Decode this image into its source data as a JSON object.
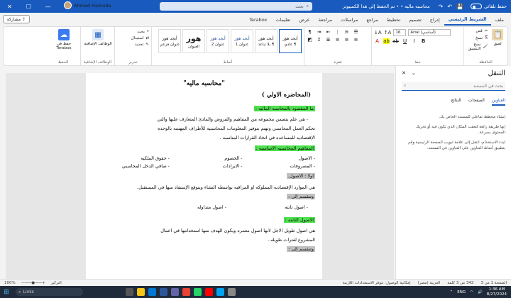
{
  "titlebar": {
    "autosave_label": "حفظ تلقائي",
    "doc_title": "محاسبه ماليه • • تم الحفظ إلى هذا الكمبيوتر",
    "search_placeholder": "بحث",
    "user_name": "Ahmed Hamada"
  },
  "tabs": [
    "ملف",
    "الشريط الرئيسي",
    "إدراج",
    "تصميم",
    "تخطيط",
    "مراجع",
    "مراسلات",
    "مراجعة",
    "عرض",
    "تعليمات",
    "Terabox"
  ],
  "active_tab": "الشريط الرئيسي",
  "share_label": "مشاركة",
  "ribbon": {
    "clipboard": {
      "label": "الحافظة",
      "paste": "لصق",
      "cut": "قص",
      "copy": "نسخ",
      "painter": "نسخ التنسيق"
    },
    "font": {
      "label": "خط",
      "name": "Arial (أساسي)",
      "size": "16"
    },
    "paragraph": {
      "label": "فقرة"
    },
    "styles": {
      "label": "أنماط",
      "items": [
        {
          "sample": "أبجد هوز",
          "name": "¶ عادي",
          "kind": "normal"
        },
        {
          "sample": "أبجد هوز",
          "name": "¶ بلا تباعد",
          "kind": "normal"
        },
        {
          "sample": "أبجد هوز",
          "name": "عنوان 1",
          "kind": "blue"
        },
        {
          "sample": "أبجد هوز",
          "name": "عنوان 2",
          "kind": "blue"
        },
        {
          "sample": "هور",
          "name": "العنوان",
          "kind": "big"
        },
        {
          "sample": "أبجد هوز",
          "name": "عنوان فرعي",
          "kind": "normal"
        }
      ]
    },
    "editing": {
      "label": "تحرير",
      "find": "بحث",
      "replace": "استبدال",
      "select": "تحديد"
    },
    "addins": {
      "label": "الوظائف الإضافية",
      "btn": "الوظائف الإضافية"
    },
    "save": {
      "label": "الحفظ",
      "btn": "حفظ في Terabox"
    }
  },
  "document": {
    "title": "\"محاسبه ماليه\"",
    "subtitle": "(المحاضره الاولي )",
    "h1": "ما المقصود بالمحاسبه الماليه :",
    "p1a": "-   هي علم يتضمن مجموعه من المفاهيم والفروض والمادئ المتعارف عليها والتي",
    "p1b": "تحكم العمل المحاسبي وتهتم بتوفير المعلومات المحاسبيه للأطراف المهتمه بالوحده",
    "p1c": "الإقتصاديه للمساعده في اتخاذ القرارات المناسبه .",
    "h2": "المفاهيم المحاسبيه الاساسيه :",
    "cols": [
      [
        "-   الاصول",
        "-   المصروفات"
      ],
      [
        "-   الخصوم",
        "-   الايرادات"
      ],
      [
        "-   حقوق الملكيه",
        "-   صافي الدخل المحاسبي"
      ]
    ],
    "h3": "اولا : الاصول.",
    "p3": "هي الموارد الإقتصاديه المملوكه او المراقبه بواسطه النشاء ويتوقع الإستفاد منها في المستقبل.",
    "h4": "وتنقسم إلى :",
    "assets_fixed": "-   اصول ثابته",
    "assets_current": "-   اصول متداوله",
    "h5": "الاصول الثابته :",
    "p5a": "هي اصول طويل الاجل لانها اصول معمره ويكون الهدف منها استخدامها في اعمال",
    "p5b": "المشروع لفترات طويله..",
    "h6": "وتنقسم إلى :"
  },
  "nav": {
    "title": "التنقل",
    "search_placeholder": "بحث في المستند",
    "tabs": [
      "العناوين",
      "الصفحات",
      "النتائج"
    ],
    "active_tab": "العناوين",
    "text1": "إنشاء مخطط تفاعلي للمستند الخاص بك.",
    "text2": "إنها طريقة رائعة لتعقب المكان الذي تكون فيه أو تحريك المحتوى بسرعة.",
    "text3": "لبدء الاستخدام، انتقل إلى علامة تبويب الصفحة الرئيسية وقم بتطبيق أنماط العناوين على العناوين في المستند."
  },
  "status": {
    "page": "الصفحة 1 من 3",
    "words": "342 من 3 كلمة",
    "lang": "العربية (مصر)",
    "access": "إمكانية الوصول: تتوفر الاستعدادات اللازمة",
    "focus": "التركيز",
    "zoom": "100%"
  },
  "taskbar": {
    "search_placeholder": "Links",
    "time": "1:36 AM",
    "date": "8/27/2024",
    "lang": "ENG"
  },
  "colors": {
    "accent": "#185abd",
    "highlight_green": "#4ee04e",
    "highlight_gray": "#c0c0c0"
  }
}
